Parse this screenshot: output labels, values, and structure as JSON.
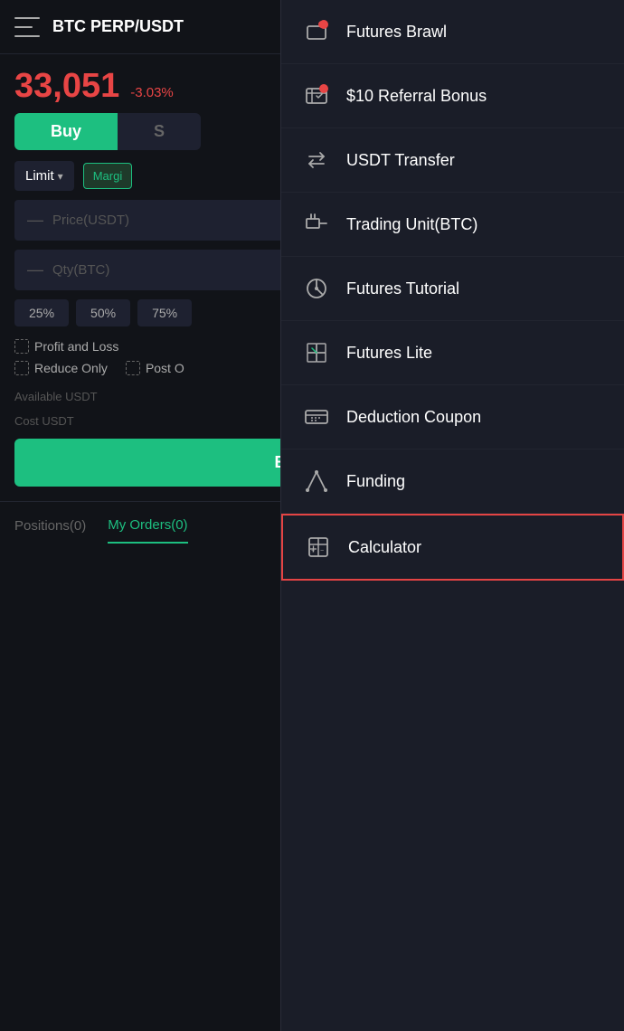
{
  "header": {
    "title": "BTC PERP/USDT",
    "menu_icon": "menu-icon",
    "chart_icon": "chart-icon",
    "settings_icon": "settings-icon",
    "more_icon": "more-icon"
  },
  "price": {
    "value": "33,051",
    "change": "-3.03%"
  },
  "trade": {
    "buy_label": "Buy",
    "sell_label": "S",
    "limit_label": "Limit",
    "margin_label": "Margi",
    "price_placeholder": "Price(USDT)",
    "qty_placeholder": "Qty(BTC)",
    "pct_buttons": [
      "25%",
      "50%",
      "75%"
    ],
    "profit_loss_label": "Profit and Loss",
    "reduce_only_label": "Reduce Only",
    "post_only_label": "Post O",
    "available_label": "Available USDT",
    "cost_label": "Cost USDT",
    "buy_long_label": "Buy/Long"
  },
  "bottom_tabs": {
    "positions_label": "Positions(0)",
    "my_orders_label": "My Orders(0)"
  },
  "menu": {
    "items": [
      {
        "id": "futures-brawl",
        "label": "Futures Brawl",
        "has_badge": true,
        "highlighted": false
      },
      {
        "id": "referral-bonus",
        "label": "$10 Referral Bonus",
        "has_badge": true,
        "highlighted": false
      },
      {
        "id": "usdt-transfer",
        "label": "USDT Transfer",
        "has_badge": false,
        "highlighted": false
      },
      {
        "id": "trading-unit",
        "label": "Trading Unit(BTC)",
        "has_badge": false,
        "highlighted": false
      },
      {
        "id": "futures-tutorial",
        "label": "Futures Tutorial",
        "has_badge": false,
        "highlighted": false
      },
      {
        "id": "futures-lite",
        "label": "Futures Lite",
        "has_badge": false,
        "highlighted": false
      },
      {
        "id": "deduction-coupon",
        "label": "Deduction Coupon",
        "has_badge": false,
        "highlighted": false
      },
      {
        "id": "funding",
        "label": "Funding",
        "has_badge": false,
        "highlighted": false
      },
      {
        "id": "calculator",
        "label": "Calculator",
        "has_badge": false,
        "highlighted": true
      }
    ]
  },
  "colors": {
    "green": "#1dbf80",
    "red": "#e84545",
    "bg": "#111318",
    "panel": "#1a1d28",
    "border": "#222530"
  }
}
